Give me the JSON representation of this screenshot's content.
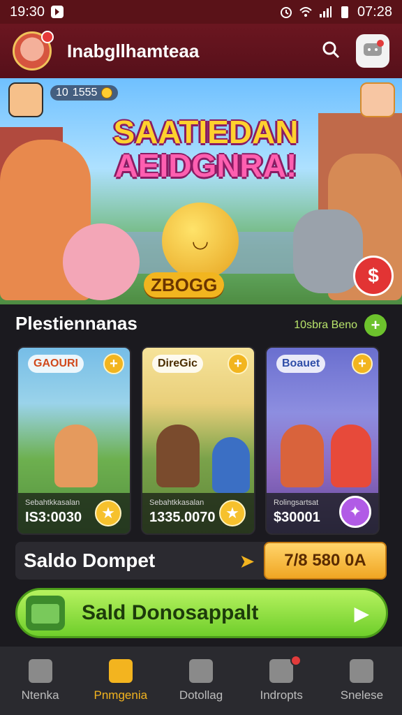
{
  "status_bar": {
    "time_left": "19:30",
    "time_right": "07:28"
  },
  "header": {
    "title": "Inabgllhamteaa",
    "icons": {
      "avatar": "avatar",
      "search": "search-icon",
      "message": "message-icon"
    }
  },
  "hero": {
    "title_line1": "SAATIEDAN",
    "title_line2": "AEIDGNRA!",
    "coins_label": "ZBOGG",
    "stat_value": "1555",
    "stat_prefix": "10",
    "action_symbol": "$"
  },
  "section": {
    "title": "Plestiennanas",
    "see_all": "10sbra Beno",
    "plus": "+"
  },
  "cards": [
    {
      "tag": "GAOURI",
      "sub": "Sebahtkkasalan",
      "price": "IS3:0030",
      "action_icon": "star-icon"
    },
    {
      "tag": "DireGic",
      "sub": "Sebahtkkasalan",
      "price": "1335.0070",
      "action_icon": "star-icon"
    },
    {
      "tag": "Boauet",
      "sub": "Rolingsartsat",
      "price": "$30001",
      "action_icon": "sparkle-icon"
    }
  ],
  "saldo": {
    "label": "Saldo Dompet",
    "value": "7/8 580 0A"
  },
  "cta": {
    "label": "Sald Donosappalt"
  },
  "nav": [
    {
      "label": "Ntenka",
      "icon": "home-icon",
      "active": false
    },
    {
      "label": "Pnmgenia",
      "icon": "games-icon",
      "active": true
    },
    {
      "label": "Dotollag",
      "icon": "wallet-icon",
      "active": false
    },
    {
      "label": "Indropts",
      "icon": "inbox-icon",
      "active": false
    },
    {
      "label": "Snelese",
      "icon": "profile-icon",
      "active": false
    }
  ],
  "colors": {
    "header_bg": "#6b1620",
    "accent_gold": "#f3b41f",
    "accent_green": "#6fce2b",
    "page_bg": "#1b1a1f"
  }
}
